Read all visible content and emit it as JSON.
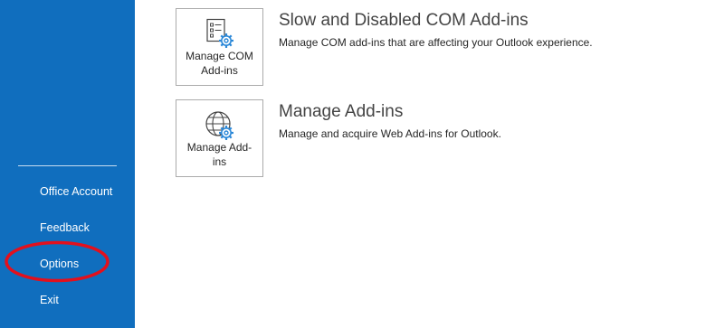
{
  "sidebar": {
    "items": [
      {
        "label": "Office Account"
      },
      {
        "label": "Feedback"
      },
      {
        "label": "Options"
      },
      {
        "label": "Exit"
      }
    ]
  },
  "sections": [
    {
      "tile_label": "Manage COM\nAdd-ins",
      "tile_icon": "com-addins-settings-icon",
      "title": "Slow and Disabled COM Add-ins",
      "description": "Manage COM add-ins that are affecting your Outlook experience."
    },
    {
      "tile_label": "Manage Add-\nins",
      "tile_icon": "web-addins-globe-settings-icon",
      "title": "Manage Add-ins",
      "description": "Manage and acquire Web Add-ins for Outlook."
    }
  ],
  "colors": {
    "sidebar_bg": "#106ebe",
    "annotation": "#e3101d",
    "tile_border": "#ababab",
    "gear_accent": "#2b88d8"
  }
}
